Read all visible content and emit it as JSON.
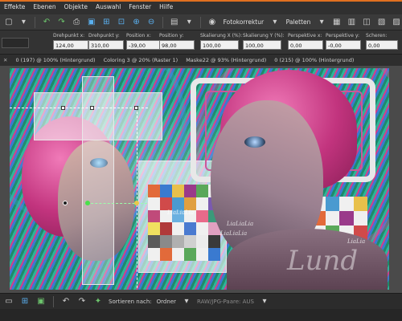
{
  "menu": [
    "Effekte",
    "Ebenen",
    "Objekte",
    "Auswahl",
    "Fenster",
    "Hilfe"
  ],
  "toolbar": {
    "fotokorrektur_label": "Fotokorrektur",
    "paletten_label": "Paletten"
  },
  "options": {
    "fields": [
      {
        "label": "Drehpunkt x:",
        "value": "124,00"
      },
      {
        "label": "Drehpunkt y:",
        "value": "310,00"
      },
      {
        "label": "Position x:",
        "value": "-39,00"
      },
      {
        "label": "Position y:",
        "value": "98,00"
      },
      {
        "label": "Skalierung X (%):",
        "value": "100,00"
      },
      {
        "label": "Skalierung Y (%):",
        "value": "100,00"
      },
      {
        "label": "Perspektive x:",
        "value": "0,00"
      },
      {
        "label": "Perspektive y:",
        "value": "-0,00"
      },
      {
        "label": "Scheren:",
        "value": "0,00"
      }
    ]
  },
  "tabs": [
    {
      "label": "0 (197) @ 100% (Hintergrund)"
    },
    {
      "label": "Coloring 3 @ 20% (Raster 1)"
    },
    {
      "label": "Maske22 @ 93% (Hintergrund)"
    },
    {
      "label": "0 (215) @ 100% (Hintergrund)"
    }
  ],
  "canvas": {
    "watermark": "Lund",
    "small_labels": [
      "LiaLiaLia",
      "LiaLiaLia",
      "LiaLiaLia",
      "LiaLia"
    ]
  },
  "bottom": {
    "sort_label": "Sortieren nach:",
    "sort_value": "Ordner",
    "raw_label": "RAW/JPG-Paare: AUS"
  },
  "colors": {
    "accent": "#e07020",
    "hair": "#d64a96"
  }
}
